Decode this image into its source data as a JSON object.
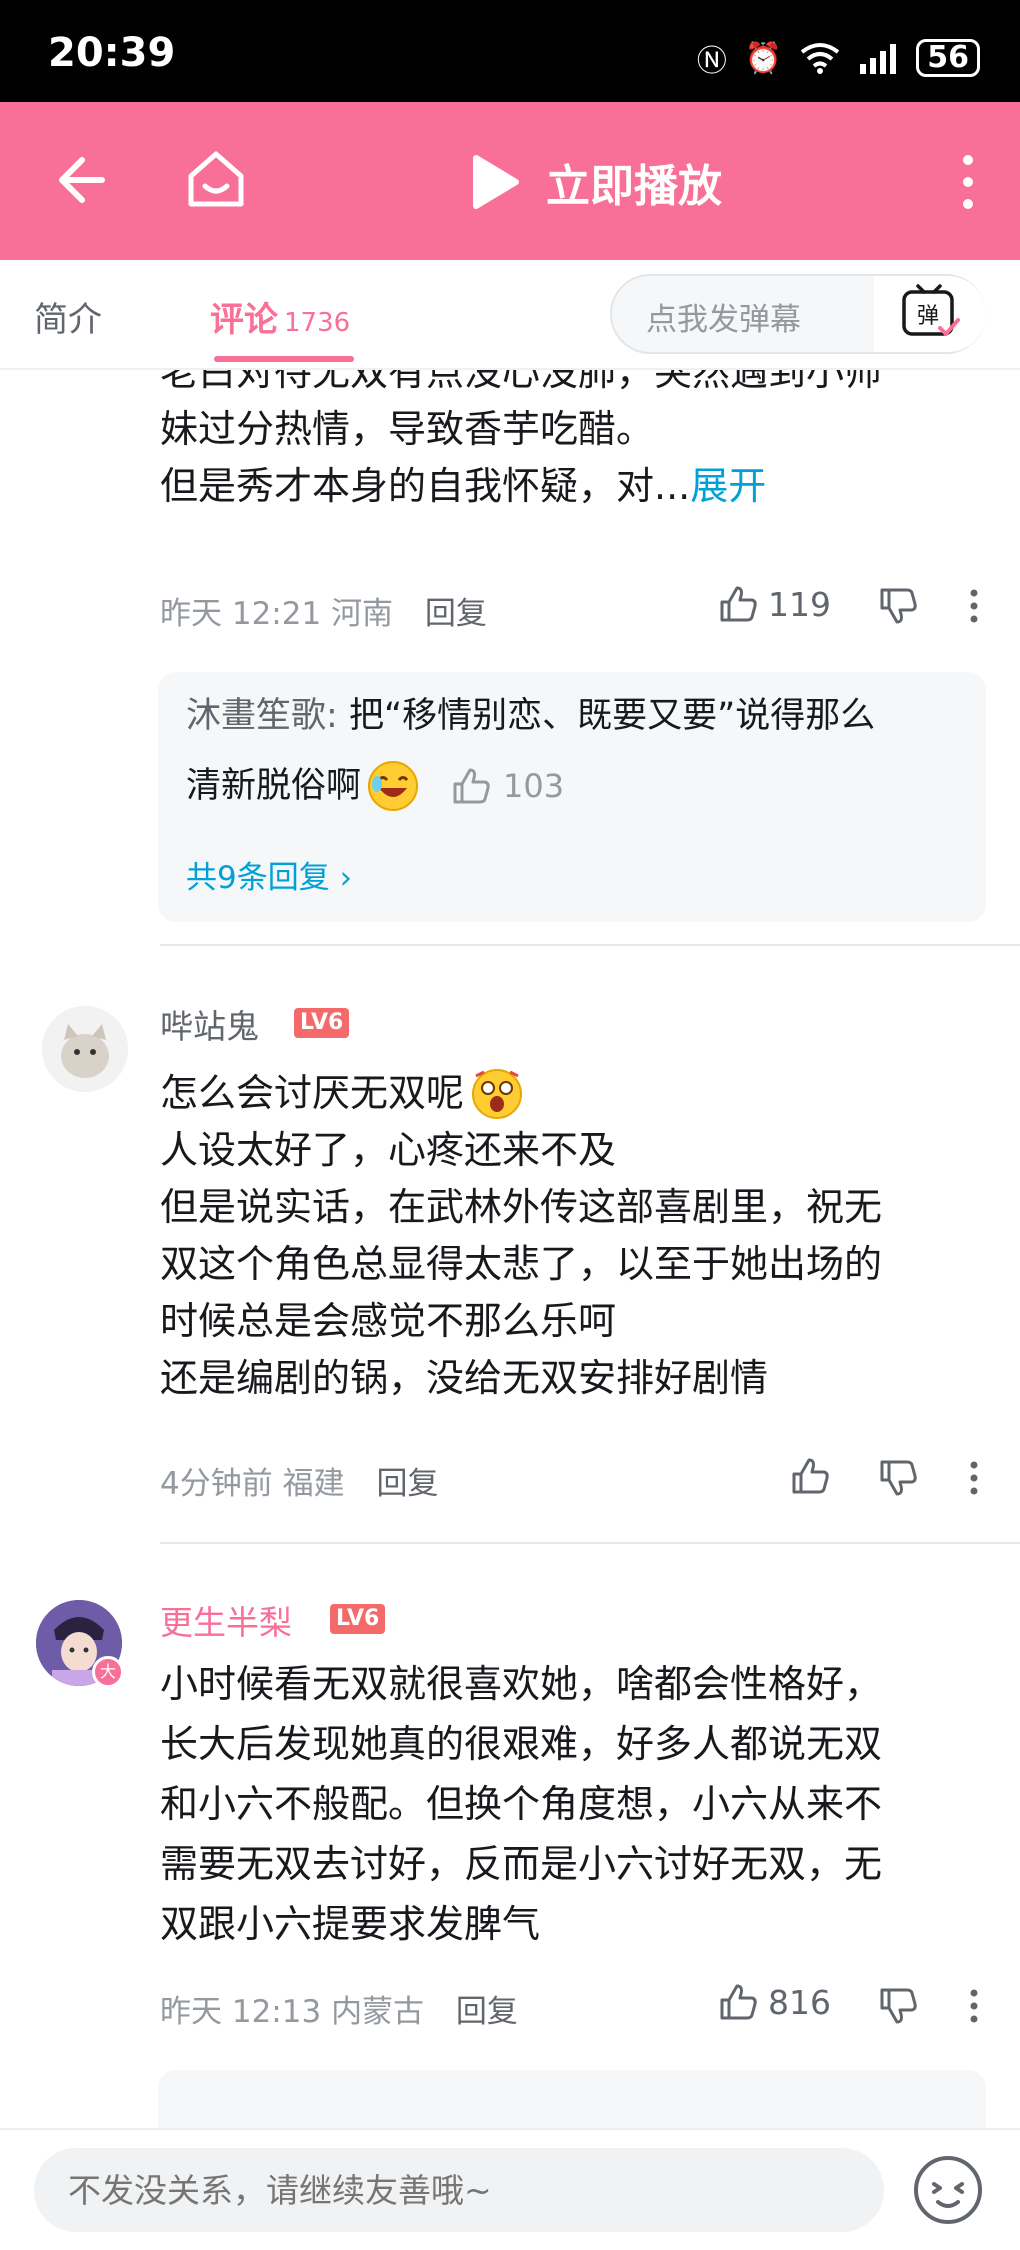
{
  "status_bar": {
    "time": "20:39",
    "battery": "56"
  },
  "app_bar": {
    "play_label": "立即播放"
  },
  "tabs": {
    "intro": "简介",
    "comments": "评论",
    "comment_count": "1736"
  },
  "danmaku": {
    "placeholder": "点我发弹幕",
    "icon_text": "弹"
  },
  "comments": [
    {
      "lines": [
        "老白对待无双有点没心没肺，突然遇到小师",
        "妹过分热情，导致香芋吃醋。",
        "但是秀才本身的自我怀疑，对..."
      ],
      "expand": "展开",
      "time": "昨天 12:21",
      "location": "河南",
      "reply": "回复",
      "likes": "119",
      "subreply": {
        "user": "沐畫笙歌:",
        "text_line1": "把“移情别恋、既要又要”说得那么",
        "text_line2": "清新脱俗啊",
        "likes": "103",
        "total": "共9条回复"
      }
    },
    {
      "user": "哔站鬼",
      "level": "LV6",
      "lines": [
        "怎么会讨厌无双呢",
        "人设太好了，心疼还来不及",
        "但是说实话，在武林外传这部喜剧里，祝无",
        "双这个角色总显得太悲了，以至于她出场的",
        "时候总是会感觉不那么乐呵",
        "还是编剧的锅，没给无双安排好剧情"
      ],
      "time": "4分钟前",
      "location": "福建",
      "reply": "回复"
    },
    {
      "user": "更生半梨",
      "level": "LV6",
      "badge": "大",
      "lines": [
        "小时候看无双就很喜欢她，啥都会性格好，",
        "长大后发现她真的很艰难，好多人都说无双",
        "和小六不般配。但换个角度想，小六从来不",
        "需要无双去讨好，反而是小六讨好无双，无",
        "双跟小六提要求发脾气"
      ],
      "time": "昨天 12:13",
      "location": "内蒙古",
      "reply": "回复",
      "likes": "816"
    }
  ],
  "bottom_bar": {
    "placeholder": "不发没关系，请继续友善哦~"
  },
  "colors": {
    "accent": "#f86f98",
    "link": "#00a1d6",
    "level": "#f46a6a"
  }
}
